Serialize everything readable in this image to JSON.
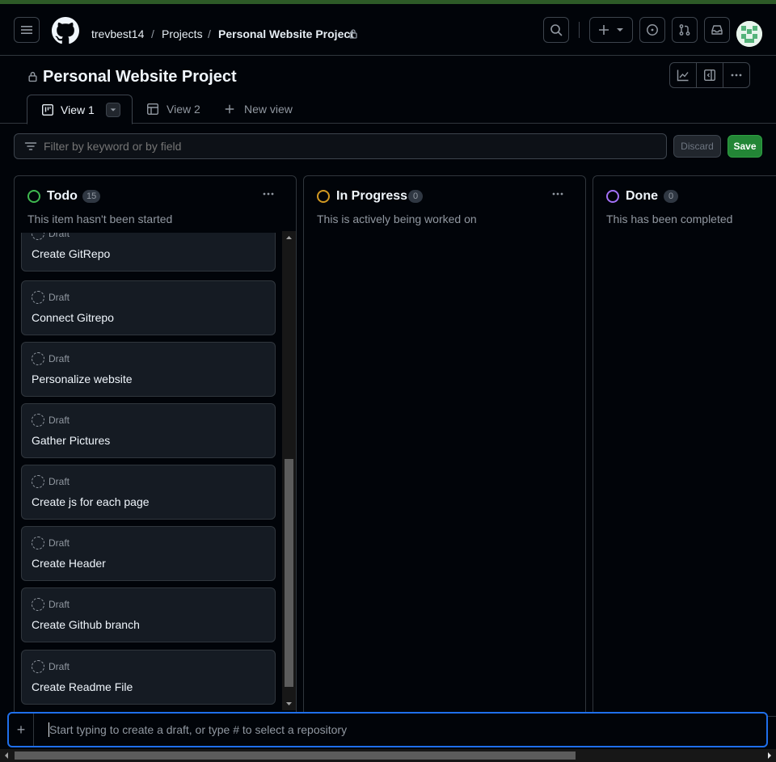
{
  "nav": {
    "user": "trevbest14",
    "sep1": "/",
    "projects": "Projects",
    "sep2": "/",
    "project": "Personal Website Project"
  },
  "header": {
    "title": "Personal Website Project"
  },
  "tabs": [
    {
      "label": "View 1",
      "icon": "board-icon",
      "active": true
    },
    {
      "label": "View 2",
      "icon": "table-icon",
      "active": false
    },
    {
      "label": "New view",
      "icon": "plus-icon",
      "active": false
    }
  ],
  "filter": {
    "placeholder": "Filter by keyword or by field",
    "discard_label": "Discard",
    "save_label": "Save"
  },
  "columns": [
    {
      "name": "Todo",
      "count": "15",
      "description": "This item hasn't been started",
      "color": "#3fb950",
      "cards": [
        {
          "status": "Draft",
          "title": "Create GitRepo"
        },
        {
          "status": "Draft",
          "title": "Connect Gitrepo"
        },
        {
          "status": "Draft",
          "title": "Personalize website"
        },
        {
          "status": "Draft",
          "title": "Gather Pictures"
        },
        {
          "status": "Draft",
          "title": "Create js for each page"
        },
        {
          "status": "Draft",
          "title": "Create Header"
        },
        {
          "status": "Draft",
          "title": "Create Github branch"
        },
        {
          "status": "Draft",
          "title": "Create Readme File"
        }
      ]
    },
    {
      "name": "In Progress",
      "count": "0",
      "description": "This is actively being worked on",
      "color": "#d29922",
      "cards": []
    },
    {
      "name": "Done",
      "count": "0",
      "description": "This has been completed",
      "color": "#a371f7",
      "cards": []
    }
  ],
  "add_item": {
    "plus": "+",
    "placeholder": "Start typing to create a draft, or type # to select a repository"
  },
  "colors": {
    "accent": "#1f6feb",
    "save": "#238636",
    "background": "#010409"
  }
}
